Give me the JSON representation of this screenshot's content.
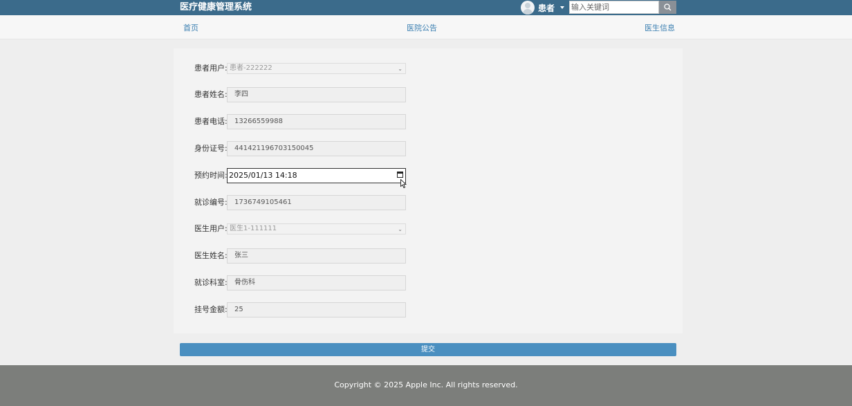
{
  "header": {
    "brand": "医疗健康管理系统",
    "username": "患者",
    "search_placeholder": "输入关键词"
  },
  "nav": {
    "home": "首页",
    "announcements": "医院公告",
    "doctor_info": "医生信息"
  },
  "form": {
    "patient_account": {
      "label": "患者用户:",
      "value": "患者-222222"
    },
    "patient_name": {
      "label": "患者姓名:",
      "value": "李四"
    },
    "patient_phone": {
      "label": "患者电话:",
      "value": "13266559988"
    },
    "id_number": {
      "label": "身份证号:",
      "value": "441421196703150045"
    },
    "appointment_time": {
      "label": "预约时间:",
      "value": "2025/01/13 14:18"
    },
    "visit_number": {
      "label": "就诊编号:",
      "value": "1736749105461"
    },
    "doctor_account": {
      "label": "医生用户:",
      "value": "医生1-111111"
    },
    "doctor_name": {
      "label": "医生姓名:",
      "value": "张三"
    },
    "department": {
      "label": "就诊科室:",
      "value": "骨伤科"
    },
    "fee": {
      "label": "挂号金额:",
      "value": "25"
    }
  },
  "submit_label": "提交",
  "footer": {
    "copyright": "Copyright © 2025 Apple Inc. All rights reserved."
  },
  "colors": {
    "header_bg": "#3b6b8b",
    "nav_link": "#3b7fb1",
    "submit_bg": "#4a8fc0",
    "footer_bg": "#7c7e7b"
  },
  "icons": {
    "search": "search-icon",
    "avatar": "avatar",
    "calendar": "calendar-icon",
    "dropdown": "chevron-down-icon"
  }
}
